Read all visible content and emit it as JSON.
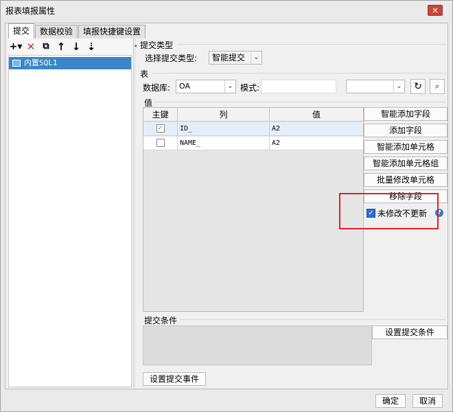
{
  "window": {
    "title": "报表填报属性",
    "close_label": "×"
  },
  "tabs": [
    {
      "label": "提交",
      "active": true
    },
    {
      "label": "数据校验",
      "active": false
    },
    {
      "label": "填报快捷键设置",
      "active": false
    }
  ],
  "left_toolbar": {
    "add": "+▾",
    "delete": "✕",
    "copy": "⧉",
    "up": "↑",
    "down": "↓",
    "sort": "⇣"
  },
  "left_list": {
    "items": [
      {
        "label": "内置SQL1",
        "selected": true
      }
    ]
  },
  "submit_type": {
    "section_label": "提交类型",
    "select_label": "选择提交类型:",
    "value": "智能提交"
  },
  "table": {
    "section_label": "表",
    "database_label": "数据库:",
    "database_value": "OA",
    "schema_label": "模式:"
  },
  "values": {
    "section_label": "值",
    "columns": [
      "主键",
      "列",
      "值"
    ],
    "rows": [
      {
        "key_checked": true,
        "column": "ID_",
        "value": "A2"
      },
      {
        "key_checked": false,
        "column": "NAME_",
        "value": "A2"
      }
    ]
  },
  "side_buttons": [
    "智能添加字段",
    "添加字段",
    "智能添加单元格",
    "智能添加单元格组",
    "批量修改单元格",
    "移除字段"
  ],
  "no_update_unmodified": {
    "label": "未修改不更新",
    "checked": true
  },
  "submit_condition": {
    "section_label": "提交条件",
    "button": "设置提交条件"
  },
  "submit_event_button": "设置提交事件",
  "footer": {
    "ok": "确定",
    "cancel": "取消"
  },
  "colors": {
    "selection": "#3a86c8",
    "highlight_box": "#e02020",
    "help_icon": "#2f7fd1"
  }
}
